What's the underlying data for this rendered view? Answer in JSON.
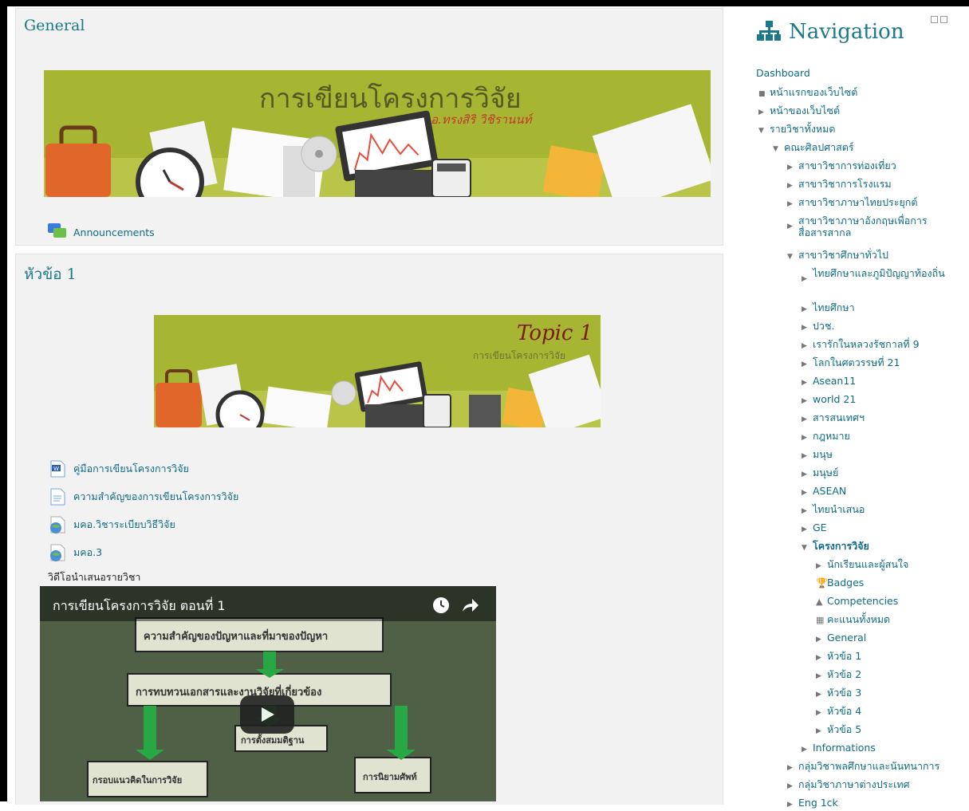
{
  "general": {
    "title": "General",
    "banner_title": "การเขียนโครงการวิจัย",
    "banner_author": "อ.ทรงสิริ วิชิรานนท์",
    "announcements": "Announcements"
  },
  "topic1": {
    "title": "หัวข้อ 1",
    "banner_title": "Topic 1",
    "banner_subtitle": "การเขียนโครงการวิจัย",
    "activities": [
      {
        "label": "คู่มือการเขียนโครงการวิจัย",
        "icon": "word-doc-icon"
      },
      {
        "label": "ความสำคัญของการเขียนโครงการวิจัย",
        "icon": "page-icon"
      },
      {
        "label": "มคอ.วิชาระเบียบวิธีวิจัย",
        "icon": "url-globe-icon"
      },
      {
        "label": "มคอ.3",
        "icon": "url-globe-icon"
      }
    ],
    "video_label": "วิดีโอนำเสนอรายวิชา",
    "video_title": "การเขียนโครงการวิจัย ตอนที่ 1",
    "video_lines": [
      "ความสำคัญของปัญหาและที่มาของปัญหา",
      "การทบทวนเอกสารและงานวิจัยที่เกี่ยวข้อง",
      "การตั้งสมมติฐาน",
      "กรอบแนวคิดในการวิจัย",
      "การนิยามศัพท์"
    ]
  },
  "nav": {
    "title": "Navigation",
    "dashboard": "Dashboard",
    "site_home": "หน้าแรกของเว็บไซต์",
    "site_pages": "หน้าของเว็บไซต์",
    "all_courses": "รายวิชาทั้งหมด",
    "faculty": "คณะศิลปศาสตร์",
    "departments": [
      "สาขาวิชาการท่องเที่ยว",
      "สาขาวิชาการโรงแรม",
      "สาขาวิชาภาษาไทยประยุกต์",
      "สาขาวิชาภาษาอังกฤษเพื่อการสื่อสารสากล",
      "สาขาวิชาศึกษาทั่วไป"
    ],
    "gen_courses": [
      "ไทยศึกษาและภูมิปัญญาท้องถิ่น",
      "ไทยศึกษา",
      "ปวช.",
      "เรารักในหลวงรัชกาลที่ 9",
      "โลกในศตวรรษที่ 21",
      "Asean11",
      "world 21",
      "สารสนเทศฯ",
      "กฎหมาย",
      "มนุษ",
      "มนุษย์",
      "ASEAN",
      "ไทยนำเสนอ",
      "GE",
      "โครงการวิจัย"
    ],
    "course_items": [
      {
        "label": "นักเรียนและผู้สนใจ",
        "icon": "arrow"
      },
      {
        "label": "Badges",
        "icon": "trophy-icon"
      },
      {
        "label": "Competencies",
        "icon": "competency-icon"
      },
      {
        "label": "คะแนนทั้งหมด",
        "icon": "grades-table-icon"
      },
      {
        "label": "General",
        "icon": "arrow"
      },
      {
        "label": "หัวข้อ 1",
        "icon": "arrow"
      },
      {
        "label": "หัวข้อ 2",
        "icon": "arrow"
      },
      {
        "label": "หัวข้อ 3",
        "icon": "arrow"
      },
      {
        "label": "หัวข้อ 4",
        "icon": "arrow"
      },
      {
        "label": "หัวข้อ 5",
        "icon": "arrow"
      }
    ],
    "informations": "Informations",
    "groups": [
      "กลุ่มวิชาพลศึกษาและนันทนาการ",
      "กลุ่มวิชาภาษาต่างประเทศ",
      "Eng 1ck"
    ]
  }
}
